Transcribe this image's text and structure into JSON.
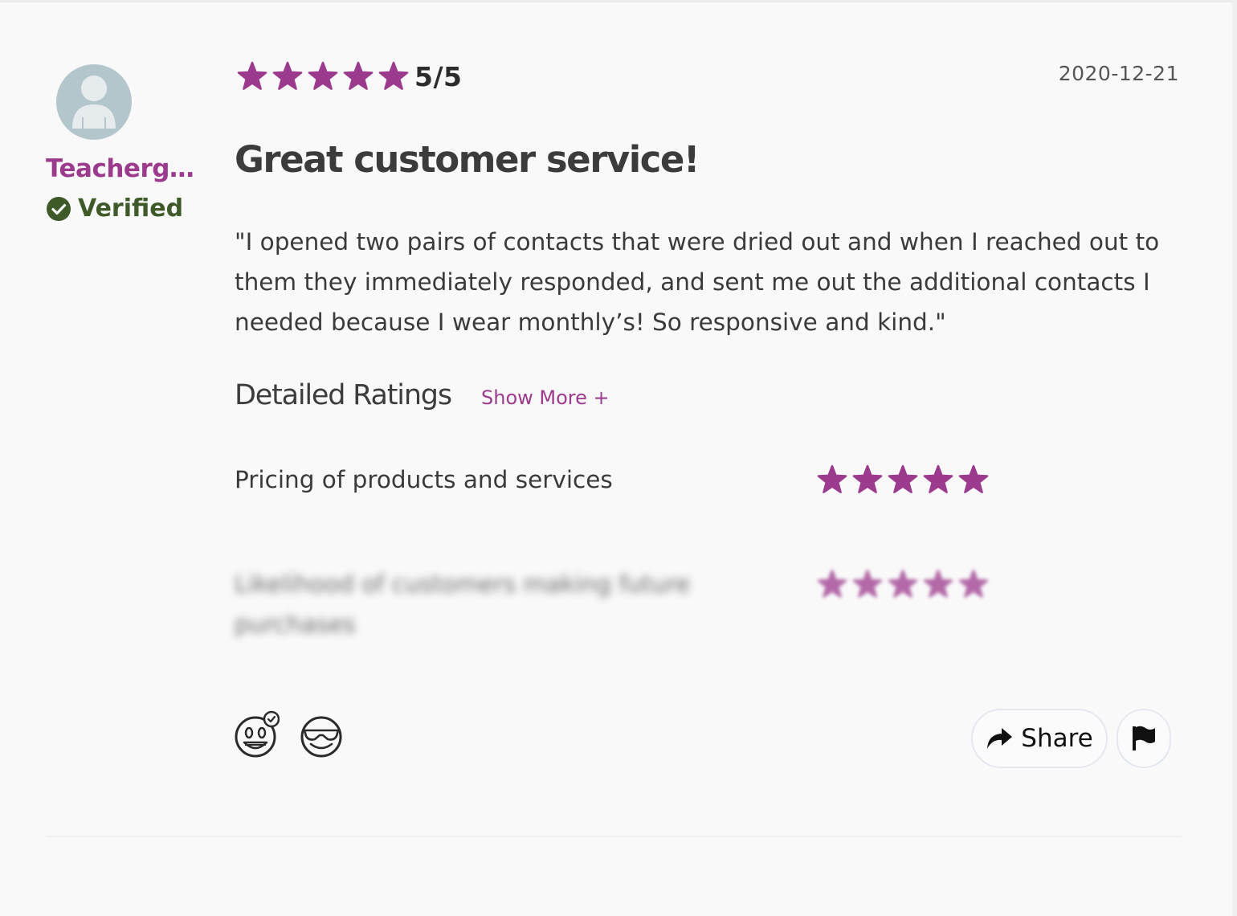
{
  "colors": {
    "accent": "#9c3a8d",
    "verified_green": "#3d5a28",
    "background": "#f9f9f9",
    "avatar_bg": "#b3c6cc"
  },
  "author": {
    "name": "Teachergal...",
    "verified_label": "Verified",
    "avatar_icon": "user-silhouette-icon"
  },
  "review": {
    "rating": 5,
    "rating_max": 5,
    "score_text": "5/5",
    "date": "2020-12-21",
    "title": "Great customer service!",
    "body": "\"I opened two pairs of contacts that were dried out and when I reached out to them they immediately responded, and sent me out the additional contacts I needed because I wear monthly’s! So responsive and kind.\""
  },
  "detailed_ratings": {
    "heading": "Detailed Ratings",
    "show_more_label": "Show More +",
    "items": [
      {
        "label": "Pricing of products and services",
        "stars": 5,
        "blurred": false
      },
      {
        "label": "Likelihood of customers making future purchases",
        "stars": 5,
        "blurred": true
      }
    ]
  },
  "actions": {
    "share_label": "Share",
    "share_icon": "share-arrow-icon",
    "flag_icon": "flag-icon",
    "reactions": [
      "grinning-face-with-check-icon",
      "sunglasses-face-icon"
    ]
  }
}
